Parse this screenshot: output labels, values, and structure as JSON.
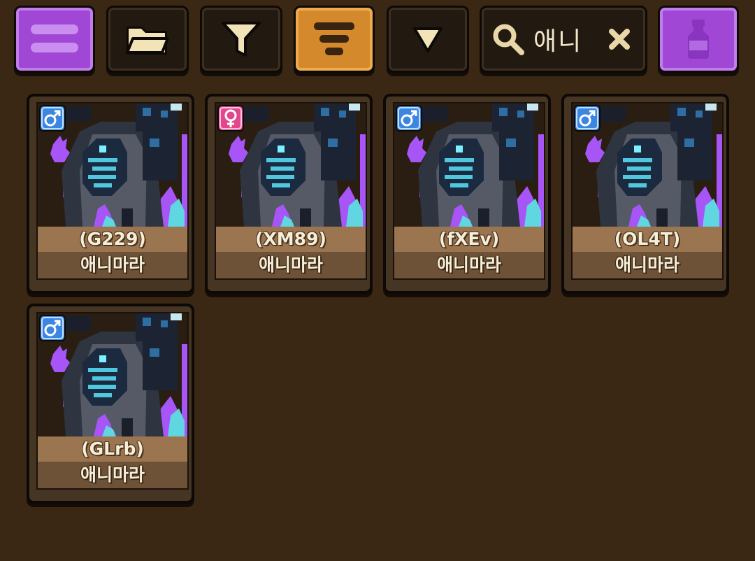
{
  "toolbar": {
    "menu_icon": "menu-icon",
    "folder_icon": "folder-icon",
    "filter_icon": "filter-icon",
    "sort_icon": "sort-icon",
    "dropdown_icon": "triangle-down-icon",
    "search": {
      "icon": "search-icon",
      "value": "애니",
      "clear_icon": "close-icon"
    },
    "potion_icon": "potion-icon"
  },
  "colors": {
    "background": "#3a2815",
    "accent_purple": "#a047d6",
    "accent_orange": "#d48a2c",
    "male": "#3d86e0",
    "female": "#e0488d",
    "flame_purple": "#a855f7",
    "flame_cyan": "#5fd6e0"
  },
  "cards": [
    {
      "id": "(G229)",
      "name": "애니마라",
      "gender": "male"
    },
    {
      "id": "(XM89)",
      "name": "애니마라",
      "gender": "female"
    },
    {
      "id": "(fXEv)",
      "name": "애니마라",
      "gender": "male"
    },
    {
      "id": "(OL4T)",
      "name": "애니마라",
      "gender": "male"
    },
    {
      "id": "(GLrb)",
      "name": "애니마라",
      "gender": "male"
    }
  ]
}
